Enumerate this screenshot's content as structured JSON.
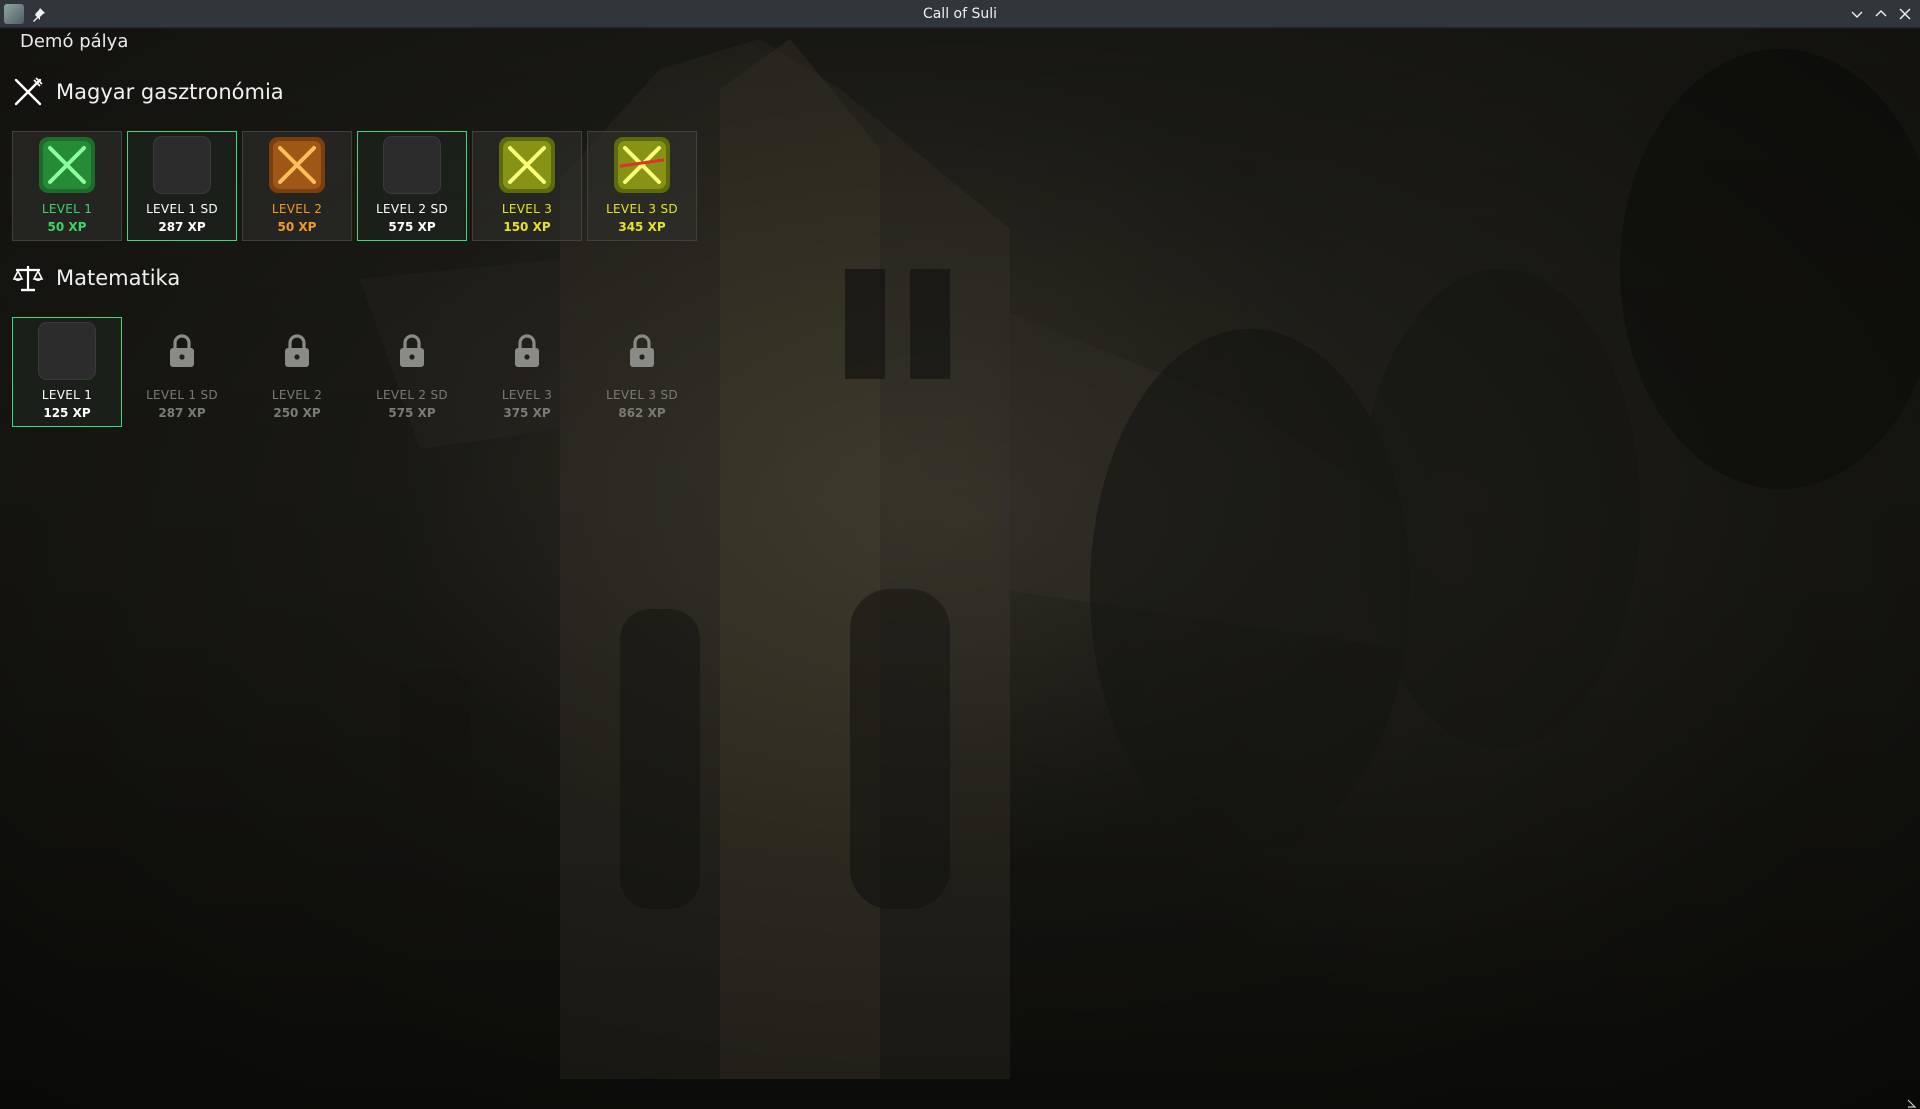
{
  "window": {
    "title": "Call of Suli"
  },
  "page": {
    "heading": "Demó pálya"
  },
  "sections": [
    {
      "title": "Magyar gasztronómia",
      "icon": "fork-knife-icon",
      "levels": [
        {
          "label": "LEVEL 1",
          "xp": "50 XP",
          "state": "completed",
          "color": "#3bd36c"
        },
        {
          "label": "LEVEL 1 SD",
          "xp": "287 XP",
          "state": "available",
          "color": "#ffffff"
        },
        {
          "label": "LEVEL 2",
          "xp": "50 XP",
          "state": "completed",
          "color": "#f29b23"
        },
        {
          "label": "LEVEL 2 SD",
          "xp": "575 XP",
          "state": "available",
          "color": "#ffffff"
        },
        {
          "label": "LEVEL 3",
          "xp": "150 XP",
          "state": "completed",
          "color": "#e6e22a"
        },
        {
          "label": "LEVEL 3 SD",
          "xp": "345 XP",
          "state": "completed",
          "color": "#e6e22a"
        }
      ]
    },
    {
      "title": "Matematika",
      "icon": "scales-icon",
      "levels": [
        {
          "label": "LEVEL 1",
          "xp": "125 XP",
          "state": "available",
          "color": "#ffffff"
        },
        {
          "label": "LEVEL 1 SD",
          "xp": "287 XP",
          "state": "locked",
          "color": "#7b7a74"
        },
        {
          "label": "LEVEL 2",
          "xp": "250 XP",
          "state": "locked",
          "color": "#7b7a74"
        },
        {
          "label": "LEVEL 2 SD",
          "xp": "575 XP",
          "state": "locked",
          "color": "#7b7a74"
        },
        {
          "label": "LEVEL 3",
          "xp": "375 XP",
          "state": "locked",
          "color": "#7b7a74"
        },
        {
          "label": "LEVEL 3 SD",
          "xp": "862 XP",
          "state": "locked",
          "color": "#7b7a74"
        }
      ]
    }
  ],
  "colors": {
    "accent_selected": "#3ad97a",
    "titlebar": "#31363b"
  }
}
